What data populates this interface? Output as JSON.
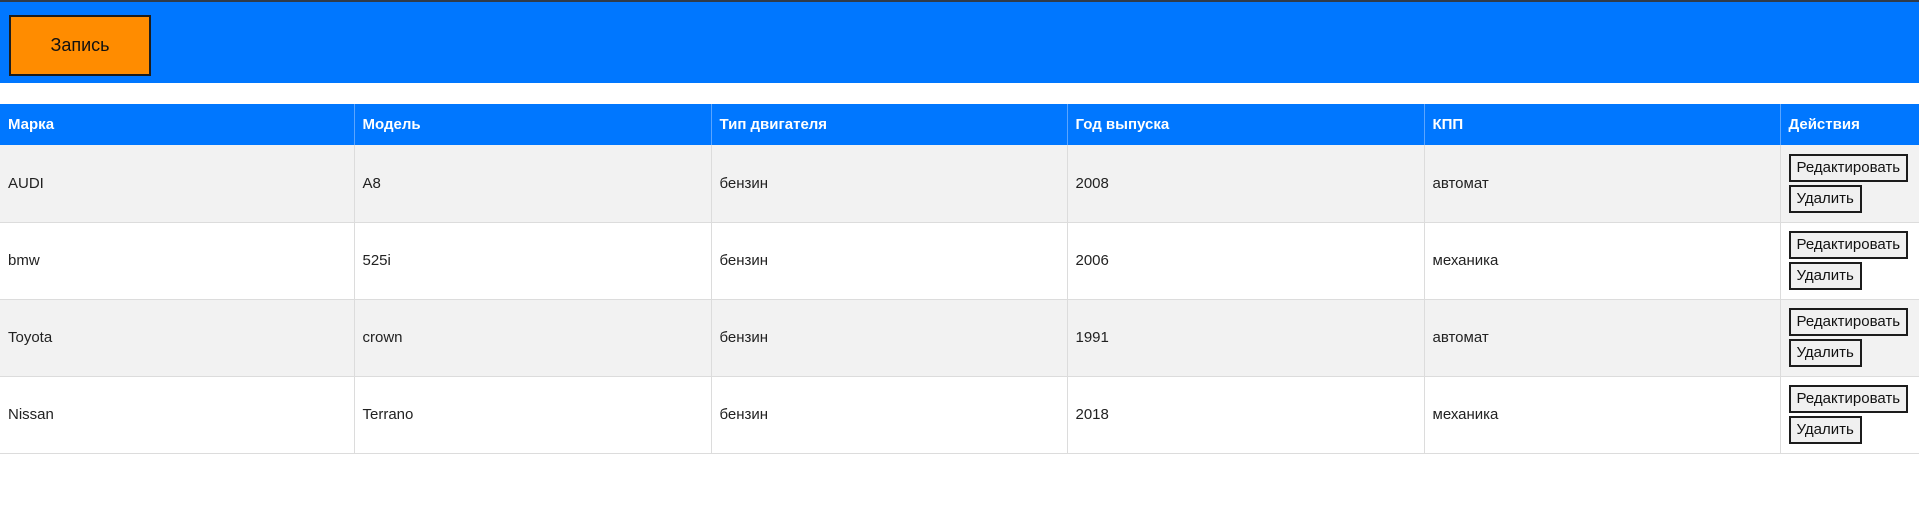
{
  "header": {
    "record_label": "Запись"
  },
  "table": {
    "columns": [
      "Марка",
      "Модель",
      "Тип двигателя",
      "Год выпуска",
      "КПП",
      "Действия"
    ],
    "rows": [
      {
        "brand": "AUDI",
        "model": "A8",
        "engine": "бензин",
        "year": "2008",
        "gearbox": "автомат"
      },
      {
        "brand": "bmw",
        "model": "525i",
        "engine": "бензин",
        "year": "2006",
        "gearbox": "механика"
      },
      {
        "brand": "Toyota",
        "model": "crown",
        "engine": "бензин",
        "year": "1991",
        "gearbox": "автомат"
      },
      {
        "brand": "Nissan",
        "model": "Terrano",
        "engine": "бензин",
        "year": "2018",
        "gearbox": "механика"
      }
    ],
    "actions": {
      "edit_label": "Редактировать",
      "delete_label": "Удалить"
    }
  },
  "colors": {
    "header_bg": "#0077ff",
    "record_button": "#ff8c00",
    "row_alt": "#f2f2f2"
  }
}
